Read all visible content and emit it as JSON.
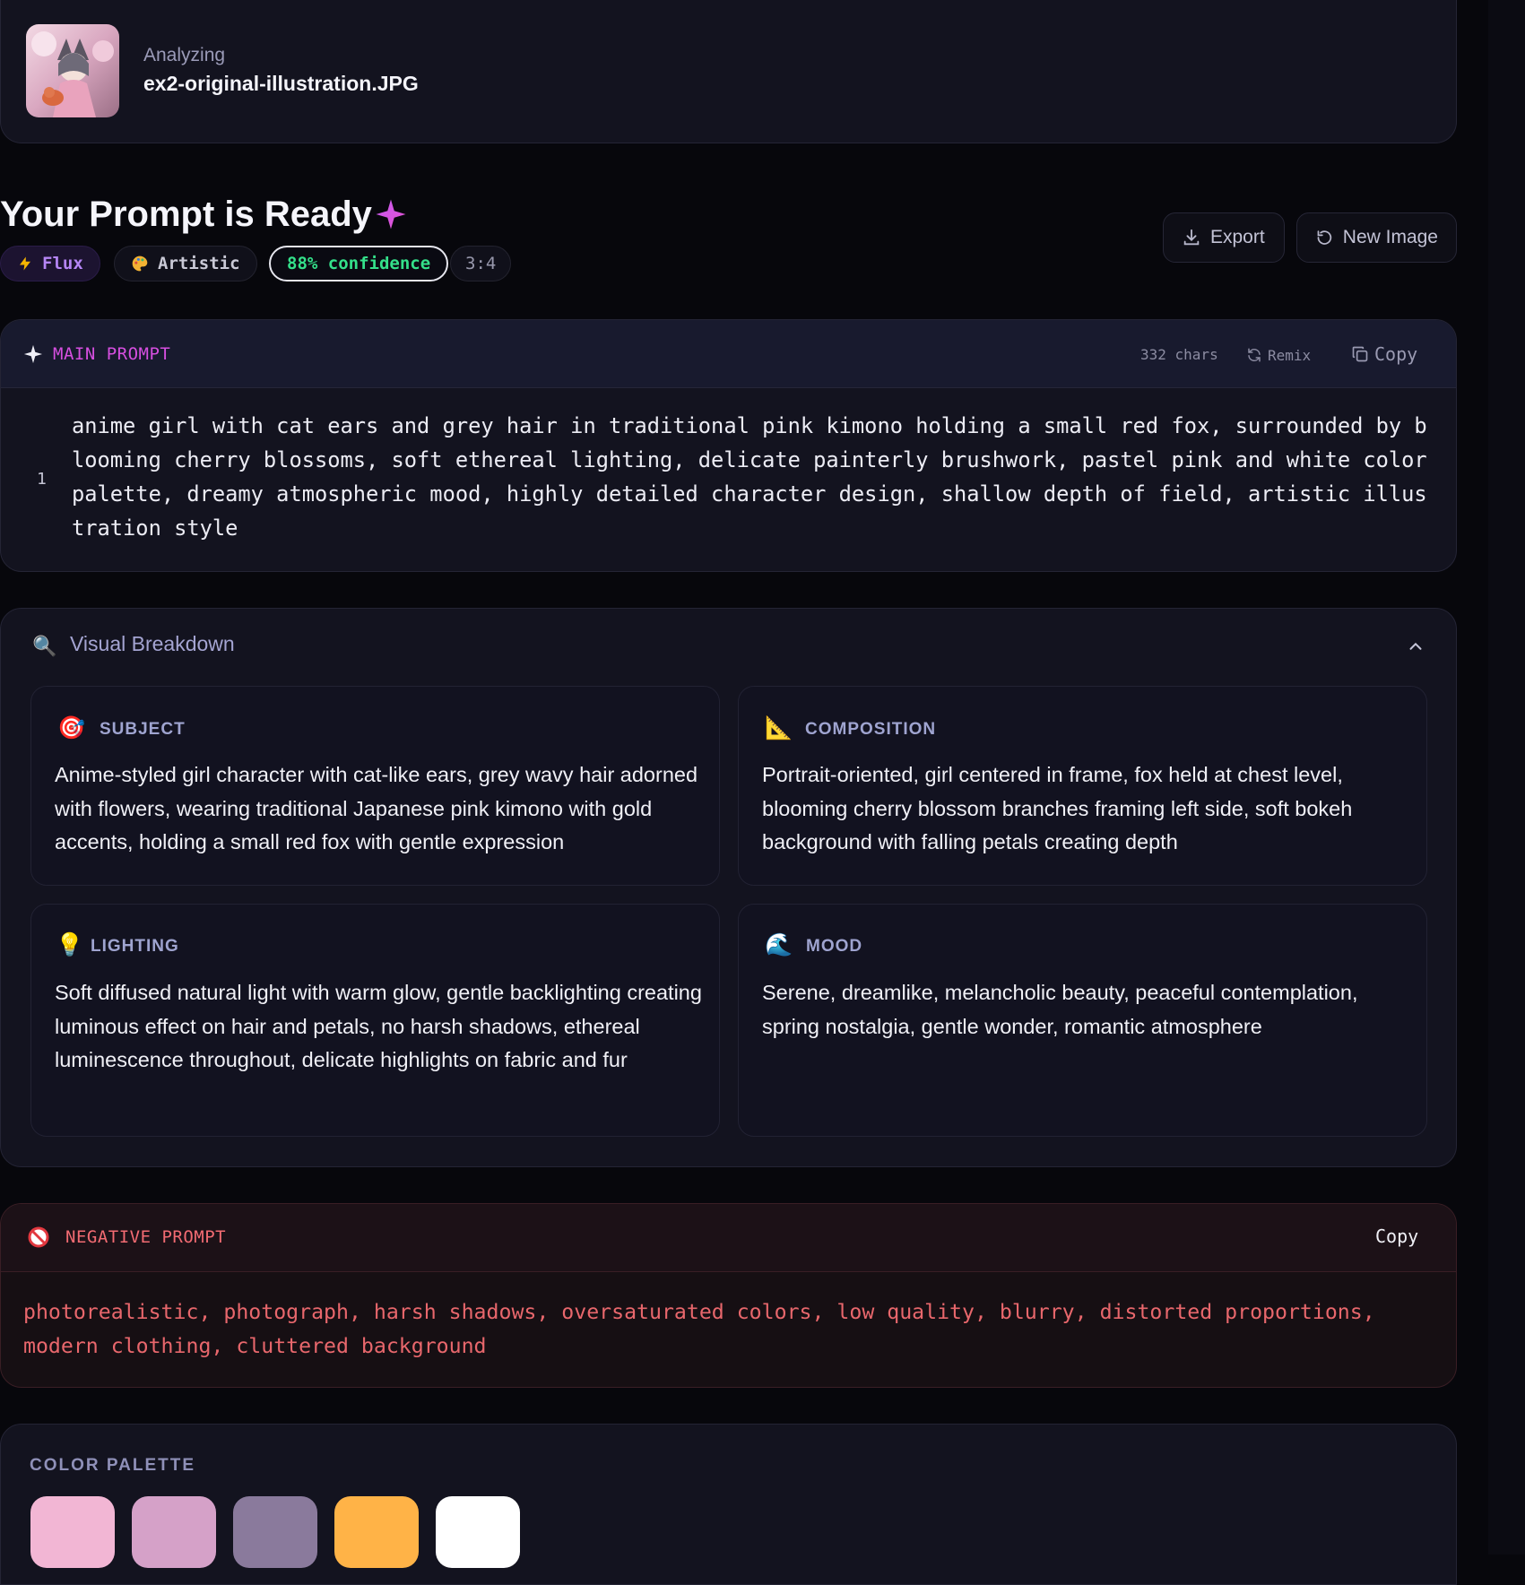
{
  "file": {
    "status": "Analyzing",
    "name": "ex2-original-illustration.JPG"
  },
  "header": {
    "title": "Your Prompt is Ready",
    "badges": {
      "model": "Flux",
      "style": "Artistic",
      "confidence": "88% confidence",
      "ratio": "3:4"
    },
    "export_label": "Export",
    "new_image_label": "New Image"
  },
  "main_prompt": {
    "label": "MAIN PROMPT",
    "char_count": "332 chars",
    "remix_label": "Remix",
    "copy_label": "Copy",
    "line_number": "1",
    "text": "anime girl with cat ears and grey hair in traditional pink kimono holding a small red fox, surrounded by blooming cherry blossoms, soft ethereal lighting, delicate painterly brushwork, pastel pink and white color palette, dreamy atmospheric mood, highly detailed character design, shallow depth of field, artistic illustration style"
  },
  "breakdown": {
    "title": "Visual Breakdown",
    "items": [
      {
        "icon": "🎯",
        "label": "SUBJECT",
        "text": "Anime-styled girl character with cat-like ears, grey wavy hair adorned with flowers, wearing traditional Japanese pink kimono with gold accents, holding a small red fox with gentle expression"
      },
      {
        "icon": "📐",
        "label": "COMPOSITION",
        "text": "Portrait-oriented, girl centered in frame, fox held at chest level, blooming cherry blossom branches framing left side, soft bokeh background with falling petals creating depth"
      },
      {
        "icon": "💡",
        "label": "LIGHTING",
        "text": "Soft diffused natural light with warm glow, gentle backlighting creating luminous effect on hair and petals, no harsh shadows, ethereal luminescence throughout, delicate highlights on fabric and fur"
      },
      {
        "icon": "🌊",
        "label": "MOOD",
        "text": "Serene, dreamlike, melancholic beauty, peaceful contemplation, spring nostalgia, gentle wonder, romantic atmosphere"
      }
    ]
  },
  "negative_prompt": {
    "label": "NEGATIVE PROMPT",
    "copy_label": "Copy",
    "text": "photorealistic, photograph, harsh shadows, oversaturated colors, low quality, blurry, distorted proportions, modern clothing, cluttered background"
  },
  "palette": {
    "label": "COLOR PALETTE",
    "colors": [
      "#f2b6d4",
      "#d5a1c8",
      "#8a7a9c",
      "#ffb347",
      "#ffffff"
    ]
  },
  "colors": {
    "accent_magenta": "#d64fe0",
    "confidence_green": "#34e08a",
    "negative_red": "#e8676c"
  }
}
